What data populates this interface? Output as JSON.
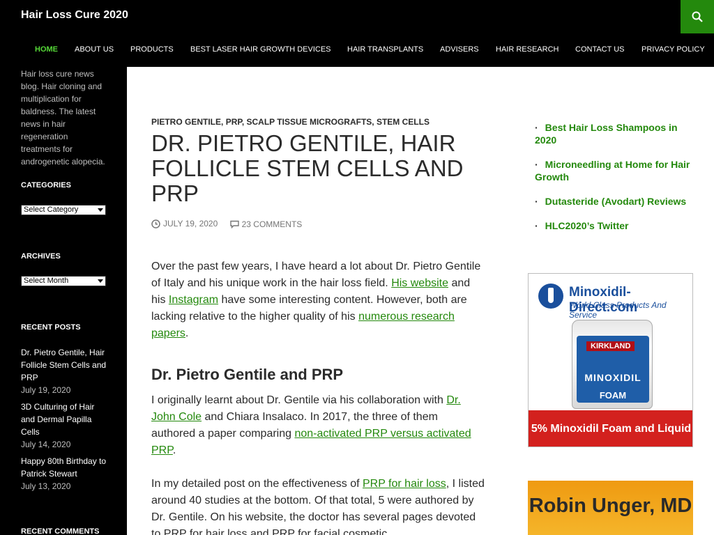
{
  "site": {
    "title": "Hair Loss Cure 2020",
    "description": "Hair loss cure news blog. Hair cloning and multiplication for baldness. The latest news in hair regeneration treatments for androgenetic alopecia."
  },
  "nav": {
    "items": [
      {
        "label": "HOME",
        "active": true
      },
      {
        "label": "ABOUT US"
      },
      {
        "label": "PRODUCTS"
      },
      {
        "label": "BEST LASER HAIR GROWTH DEVICES"
      },
      {
        "label": "HAIR TRANSPLANTS"
      },
      {
        "label": "ADVISERS"
      },
      {
        "label": "HAIR RESEARCH"
      },
      {
        "label": "CONTACT US"
      },
      {
        "label": "PRIVACY POLICY"
      }
    ],
    "search_icon": "search-icon"
  },
  "sidebar": {
    "categories_title": "CATEGORIES",
    "categories_select": "Select Category",
    "archives_title": "ARCHIVES",
    "archives_select": "Select Month",
    "recent_posts_title": "RECENT POSTS",
    "recent_posts": [
      {
        "title": "Dr. Pietro Gentile, Hair Follicle Stem Cells and PRP",
        "date": "July 19, 2020"
      },
      {
        "title": "3D Culturing of Hair and Dermal Papilla Cells",
        "date": "July 14, 2020"
      },
      {
        "title": "Happy 80th Birthday to Patrick Stewart",
        "date": "July 13, 2020"
      }
    ],
    "recent_comments_title": "RECENT COMMENTS"
  },
  "article": {
    "categories": [
      "PIETRO GENTILE",
      "PRP",
      "SCALP TISSUE MICROGRAFTS",
      "STEM CELLS"
    ],
    "title": "DR. PIETRO GENTILE, HAIR FOLLICLE STEM CELLS AND PRP",
    "date": "JULY 19, 2020",
    "comments": "23 COMMENTS",
    "p1": {
      "t1": "Over the past few years, I have heard a lot about Dr. Pietro Gentile of Italy and his unique work in the hair loss field. ",
      "l1": "His website",
      "t2": " and his ",
      "l2": "Instagram",
      "t3": " have some interesting content. However, both are lacking relative to the higher quality of his ",
      "l3": "numerous research papers",
      "t4": "."
    },
    "subheading": "Dr. Pietro Gentile and PRP",
    "p2": {
      "t1": "I originally learnt about Dr. Gentile via his collaboration with ",
      "l1": "Dr. John Cole",
      "t2": " and Chiara Insalaco. In 2017, the three of them authored a paper comparing ",
      "l2": "non-activated PRP versus activated PRP",
      "t3": "."
    },
    "p3": {
      "t1": "In my detailed post on the effectiveness of ",
      "l1": "PRP for hair loss",
      "t2": ", I listed around 40 studies at the bottom. Of that total, 5 were authored by Dr. Gentile. On his website, the doctor has several pages devoted to PRP for hair loss and PRP for facial cosmetic"
    }
  },
  "right_sidebar": {
    "links": [
      "Best Hair Loss Shampoos in 2020",
      "Microneedling at Home for Hair Growth",
      "Dutasteride (Avodart) Reviews",
      "HLC2020’s Twitter"
    ],
    "ad1": {
      "brand": "Minoxidil-Direct.com",
      "tagline": "World Class Products And Service",
      "can_brand": "KIRKLAND",
      "can_product": "MINOXIDIL",
      "can_type": "FOAM",
      "bottom": "5% Minoxidil Foam and Liquid"
    },
    "ad2": {
      "text": "Robin Unger, MD"
    }
  },
  "colors": {
    "accent": "#24890d",
    "nav_active": "#55d737",
    "header_bg": "#000000"
  }
}
